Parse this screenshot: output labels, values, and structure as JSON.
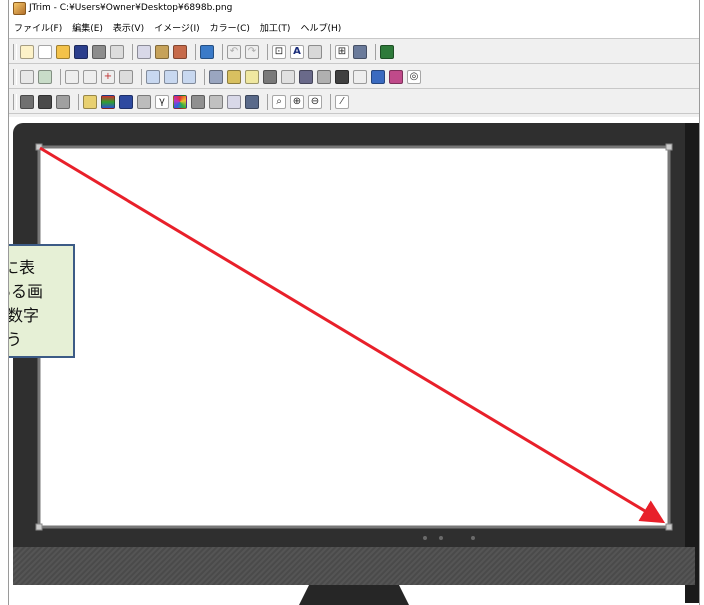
{
  "window": {
    "title": "JTrim - C:¥Users¥Owner¥Desktop¥6898b.png"
  },
  "menu": [
    {
      "label": "ファイル(F)"
    },
    {
      "label": "編集(E)"
    },
    {
      "label": "表示(V)"
    },
    {
      "label": "イメージ(I)"
    },
    {
      "label": "カラー(C)"
    },
    {
      "label": "加工(T)"
    },
    {
      "label": "ヘルプ(H)"
    }
  ],
  "toolbars": {
    "row1": [
      "new-window-icon",
      "new-file-icon",
      "open-folder-icon",
      "save-icon",
      "print-icon",
      "print-preview-icon",
      "copy-icon",
      "paste-icon",
      "paste-new-icon",
      "select-icon",
      "undo-icon",
      "redo-icon",
      "fit-window-icon",
      "text-icon",
      "circle-icon",
      "grid-icon",
      "layer-icon",
      "color-palette-icon"
    ],
    "row2": [
      "rotate-icon",
      "resize-icon",
      "flip-h-icon",
      "flip-v-icon",
      "move-icon",
      "crop-icon",
      "rotate-90-left-icon",
      "rotate-90-right-icon",
      "rotate-free-icon",
      "frame-icon",
      "fill-icon",
      "sparkle-icon",
      "mosaic-icon",
      "wave-icon",
      "blend-icon",
      "gradient-icon",
      "square-icon",
      "border-icon",
      "pencil-icon",
      "brush-icon",
      "spiral-icon"
    ],
    "row3": [
      "contrast-icon",
      "brightness-icon",
      "tone-icon",
      "effects-icon",
      "rgb-icon",
      "hue-icon",
      "gray-icon",
      "gamma-icon",
      "color-wheel-icon",
      "noise-icon",
      "blur-icon",
      "hdr-icon",
      "levels-icon",
      "zoom-menu-icon",
      "zoom-in-icon",
      "zoom-out-icon",
      "eyedropper-icon"
    ]
  },
  "callout": {
    "lines": [
      "に表",
      "ある画",
      "数字",
      "う"
    ]
  },
  "colors": {
    "arrow": "#e8202a",
    "monitor_body": "#2f2f2f",
    "callout_bg": "#e6f0d6",
    "callout_border": "#3c5b86"
  }
}
